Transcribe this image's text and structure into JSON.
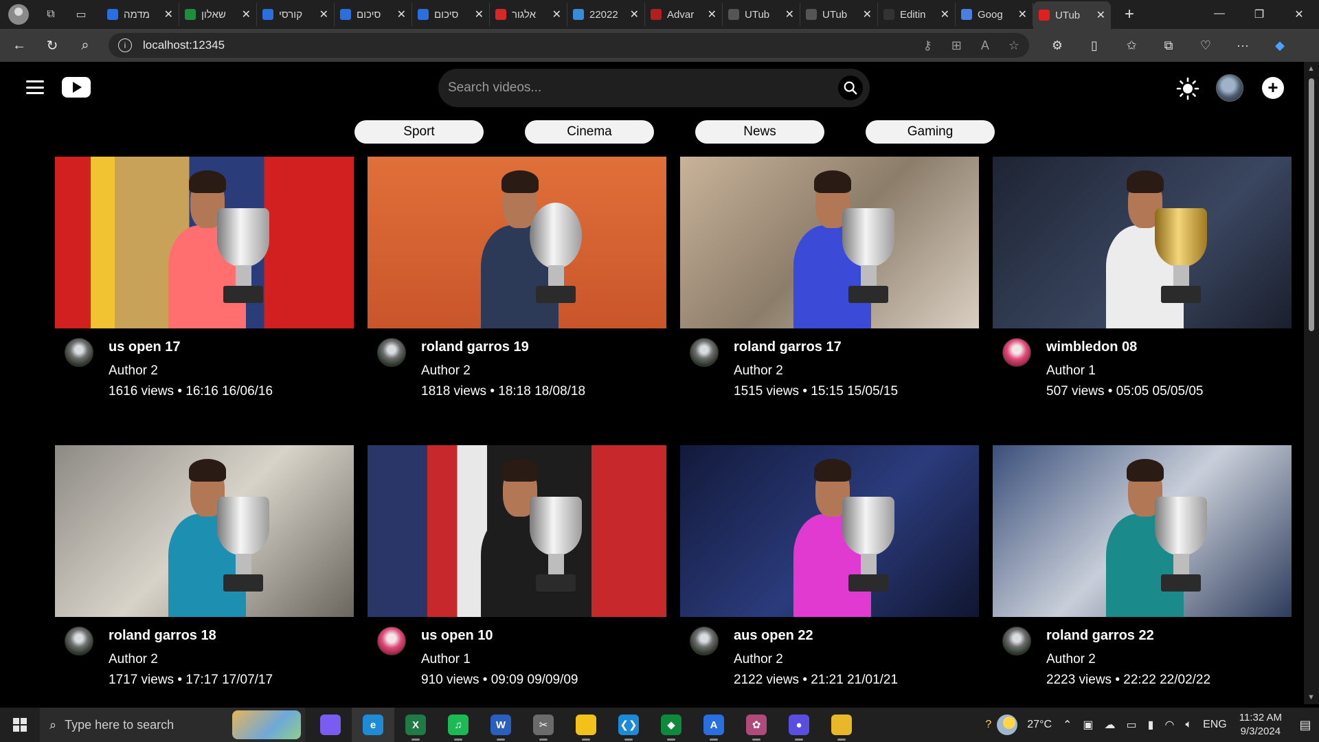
{
  "browser": {
    "tabs": [
      {
        "title": "מדמה",
        "fav_color": "#2b6ee0"
      },
      {
        "title": "שאלון",
        "fav_color": "#1e8e3e"
      },
      {
        "title": "קורסי",
        "fav_color": "#2b6ee0"
      },
      {
        "title": "סיכום",
        "fav_color": "#2b6ee0"
      },
      {
        "title": "סיכום",
        "fav_color": "#2b6ee0"
      },
      {
        "title": "אלגור",
        "fav_color": "#d62828"
      },
      {
        "title": "22022",
        "fav_color": "#3a8bd6"
      },
      {
        "title": "Advar",
        "fav_color": "#b02020"
      },
      {
        "title": "UTub",
        "fav_color": "#555555"
      },
      {
        "title": "UTub",
        "fav_color": "#555555"
      },
      {
        "title": "Editin",
        "fav_color": "#333333"
      },
      {
        "title": "Goog",
        "fav_color": "#4a7fe0"
      },
      {
        "title": "UTub",
        "fav_color": "#e02020",
        "active": true
      }
    ],
    "url": "localhost:12345"
  },
  "app": {
    "search_placeholder": "Search videos...",
    "categories": [
      "Sport",
      "Cinema",
      "News",
      "Gaming"
    ],
    "videos": [
      {
        "title": "us open 17",
        "author": "Author 2",
        "stats": "1616 views • 16:16 16/06/16",
        "avatar": "a2",
        "bg": "linear-gradient(90deg,#d21f1f 0 12%,#f1c232 12% 20%,#c9a25a 20% 45%,#2a3d7a 45% 70%,#d21f1f 70%)",
        "shirt": "#ff6f6f",
        "trophy": "silver"
      },
      {
        "title": "roland garros 19",
        "author": "Author 2",
        "stats": "1818 views • 18:18 18/08/18",
        "avatar": "a2",
        "bg": "linear-gradient(180deg,#e0703a,#c9552a)",
        "shirt": "#2c3a58",
        "trophy": "plate"
      },
      {
        "title": "roland garros 17",
        "author": "Author 2",
        "stats": "1515 views • 15:15 15/05/15",
        "avatar": "a2",
        "bg": "linear-gradient(135deg,#c9b39a,#8c7d6a 50%,#d9cfc2)",
        "shirt": "#3b4bd8",
        "trophy": "silver"
      },
      {
        "title": "wimbledon 08",
        "author": "Author 1",
        "stats": "507 views • 05:05 05/05/05",
        "avatar": "a1",
        "bg": "linear-gradient(135deg,#1e2433,#3a4660 60%,#1a1f2c)",
        "shirt": "#ececec",
        "trophy": "gold"
      },
      {
        "title": "roland garros 18",
        "author": "Author 2",
        "stats": "1717 views • 17:17 17/07/17",
        "avatar": "a2",
        "bg": "linear-gradient(135deg,#8d8a84,#d8d3c9 50%,#6a665e)",
        "shirt": "#1d8fb0",
        "trophy": "silver"
      },
      {
        "title": "us open 10",
        "author": "Author 1",
        "stats": "910 views • 09:09 09/09/09",
        "avatar": "a1",
        "bg": "linear-gradient(90deg,#2a3568 0 20%,#c7282c 20% 30%,#e8e8e8 30% 40%,#1d1d1d 40% 75%,#c7282c 75%)",
        "shirt": "#1d1d1d",
        "trophy": "silver"
      },
      {
        "title": "aus open 22",
        "author": "Author 2",
        "stats": "2122 views • 21:21 21/01/21",
        "avatar": "a2",
        "bg": "linear-gradient(135deg,#121a3a,#2b3b7c 55%,#101630)",
        "shirt": "#e13ad0",
        "trophy": "silver"
      },
      {
        "title": "roland garros 22",
        "author": "Author 2",
        "stats": "2223 views • 22:22 22/02/22",
        "avatar": "a2",
        "bg": "linear-gradient(135deg,#3a4f7a,#c9cfd9 50%,#2d3c5c)",
        "shirt": "#1a8a8a",
        "trophy": "silver"
      }
    ]
  },
  "taskbar": {
    "search_placeholder": "Type here to search",
    "apps": [
      {
        "name": "copilot-app-icon",
        "label": "",
        "color": "#7b5cf0",
        "state": ""
      },
      {
        "name": "edge-app-icon",
        "label": "e",
        "color": "#1f8ad6",
        "state": "active"
      },
      {
        "name": "excel-app-icon",
        "label": "X",
        "color": "#1f7a45",
        "state": "running"
      },
      {
        "name": "spotify-app-icon",
        "label": "♫",
        "color": "#1db954",
        "state": "running"
      },
      {
        "name": "word-app-icon",
        "label": "W",
        "color": "#2b5fbf",
        "state": "running"
      },
      {
        "name": "snipping-app-icon",
        "label": "✂",
        "color": "#6b6b6b",
        "state": "running"
      },
      {
        "name": "sticky-notes-app-icon",
        "label": "",
        "color": "#f2c21b",
        "state": "running"
      },
      {
        "name": "vscode-app-icon",
        "label": "❮❯",
        "color": "#1e8ad6",
        "state": "running"
      },
      {
        "name": "mongodb-app-icon",
        "label": "◆",
        "color": "#0f8a3c",
        "state": "running"
      },
      {
        "name": "app-store-icon",
        "label": "A",
        "color": "#2a6fe0",
        "state": "running"
      },
      {
        "name": "paint-app-icon",
        "label": "✿",
        "color": "#b04a7a",
        "state": "running"
      },
      {
        "name": "chat-app-icon",
        "label": "●",
        "color": "#5a4ee0",
        "state": "running"
      },
      {
        "name": "file-explorer-app-icon",
        "label": "",
        "color": "#e8b82a",
        "state": "running"
      }
    ],
    "temperature": "27°C",
    "language": "ENG",
    "time": "11:32 AM",
    "date": "9/3/2024"
  }
}
